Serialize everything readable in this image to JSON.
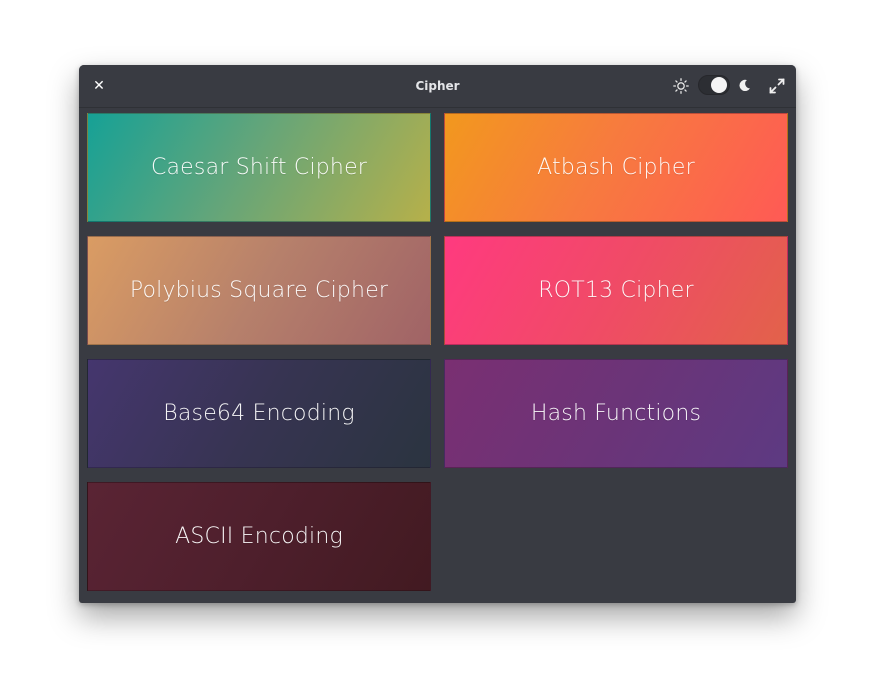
{
  "window": {
    "title": "Cipher",
    "close_glyph": "✕"
  },
  "header": {
    "theme_toggle_state": "dark",
    "icons": [
      "sun-icon",
      "moon-icon",
      "maximize-icon"
    ]
  },
  "cards": [
    {
      "label": "Caesar Shift Cipher",
      "colors": [
        "#16a196",
        "#b6b04a"
      ]
    },
    {
      "label": "Atbash Cipher",
      "colors": [
        "#f2981e",
        "#ff5a55"
      ]
    },
    {
      "label": "Polybius Square Cipher",
      "colors": [
        "#da9c63",
        "#a06366"
      ]
    },
    {
      "label": "ROT13 Cipher",
      "colors": [
        "#ff3a7f",
        "#e2624a"
      ]
    },
    {
      "label": "Base64 Encoding",
      "colors": [
        "#45366e",
        "#2b3440"
      ]
    },
    {
      "label": "Hash Functions",
      "colors": [
        "#7a2f72",
        "#5d3a82"
      ]
    },
    {
      "label": "ASCII Encoding",
      "colors": [
        "#5a2434",
        "#421a21"
      ]
    }
  ],
  "colors": {
    "window_bg": "#393b42",
    "title_text": "#e4e5e8"
  }
}
